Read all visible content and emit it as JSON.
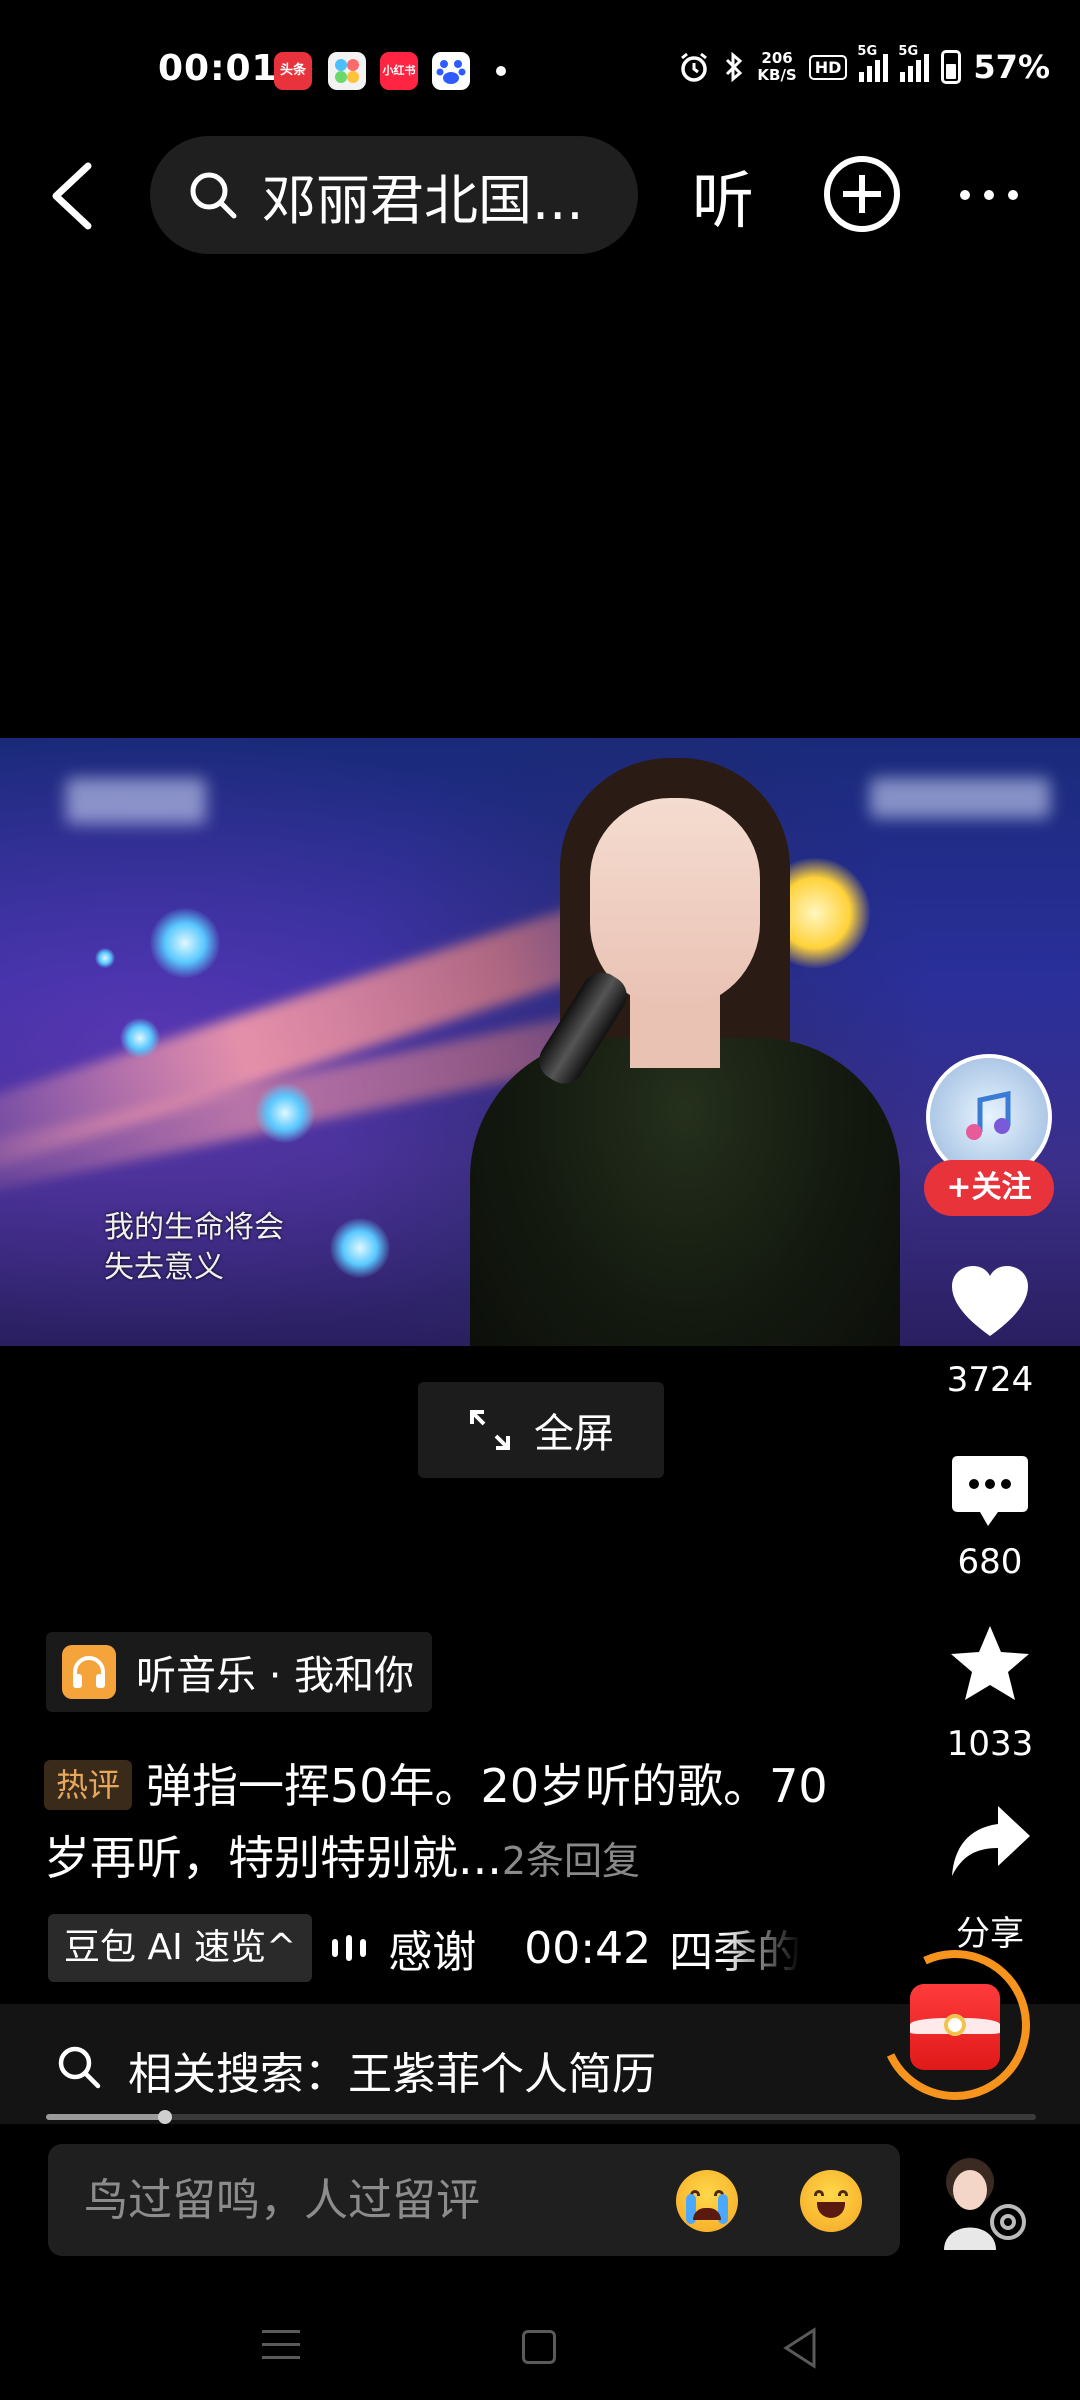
{
  "status_bar": {
    "time": "00:01",
    "app_icons": [
      {
        "name": "toutiao-icon",
        "label": "头条",
        "color": "#e8323c"
      },
      {
        "name": "photos-icon",
        "label": "",
        "color": "#f2f2f2"
      },
      {
        "name": "xiaohongshu-icon",
        "label": "小红书",
        "color": "#ff2442"
      },
      {
        "name": "baidu-icon",
        "label": "",
        "color": "#ffffff"
      }
    ],
    "net_speed_value": "206",
    "net_speed_unit": "KB/S",
    "hd_label": "HD",
    "signal_1_label": "5G",
    "signal_2_label": "5G",
    "battery_percent": "57%"
  },
  "header": {
    "search_text": "邓丽君北国...",
    "listen_label": "听"
  },
  "video": {
    "subtitle_line1": "我的生命将会",
    "subtitle_line2": "失去意义"
  },
  "fullscreen_label": "全屏",
  "rail": {
    "follow_label": "+关注",
    "like_count": "3724",
    "comment_count": "680",
    "favorite_count": "1033",
    "share_label": "分享"
  },
  "music": {
    "label": "听音乐 · 我和你"
  },
  "hot_comment": {
    "tag": "热评",
    "text": "弹指一挥50年。20岁听的歌。70岁再听，特别特别就...",
    "replies": "2条回复"
  },
  "ai_summary": {
    "chip_label": "豆包 AI 速览^",
    "text": "感谢",
    "time": "00:42",
    "more": "四季的"
  },
  "related_search": {
    "text": "相关搜索：王紫菲个人简历"
  },
  "progress": {
    "value": 0.12
  },
  "comment_input": {
    "placeholder": "鸟过留鸣，人过留评"
  },
  "colors": {
    "accent_red": "#e9333b",
    "hot_tag_text": "#e8a85c",
    "music_icon_bg": "#f4a43a",
    "ring_orange": "#f7941d"
  }
}
